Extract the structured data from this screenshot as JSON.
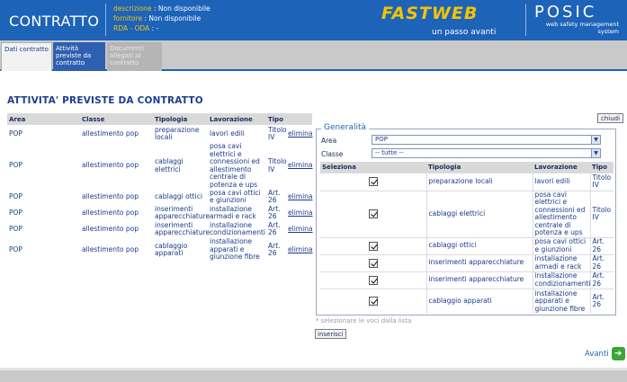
{
  "header": {
    "title": "CONTRATTO",
    "meta": [
      {
        "key": "descrizione",
        "value": ": Non disponibile"
      },
      {
        "key": "fornitore",
        "value": ": Non disponibile"
      },
      {
        "key": "RDA - ODA",
        "value": ": -"
      }
    ],
    "brand": "FASTWEB",
    "brand_tagline": "un passo avanti",
    "product": "POSIC",
    "product_tagline": "web safety management system"
  },
  "tabs": [
    {
      "label": "Dati contratto",
      "state": "inactive"
    },
    {
      "label": "Attività previste da contratto",
      "state": "active"
    },
    {
      "label": "Documenti allegati al contratto",
      "state": "disabled"
    }
  ],
  "page_title": "ATTIVITA' PREVISTE DA CONTRATTO",
  "left_table": {
    "headers": [
      "Area",
      "Classe",
      "Tipologia",
      "Lavorazione",
      "Tipo",
      ""
    ],
    "rows": [
      {
        "area": "POP",
        "classe": "allestimento pop",
        "tipologia": "preparazione locali",
        "lavorazione": "lavori edili",
        "tipo": "Titolo IV",
        "action": "elimina"
      },
      {
        "area": "POP",
        "classe": "allestimento pop",
        "tipologia": "cablaggi elettrici",
        "lavorazione": "posa cavi elettrici e connessioni ed allestimento centrale di potenza e ups",
        "tipo": "Titolo IV",
        "action": "elimina"
      },
      {
        "area": "POP",
        "classe": "allestimento pop",
        "tipologia": "cablaggi ottici",
        "lavorazione": "posa cavi ottici e giunzioni",
        "tipo": "Art. 26",
        "action": "elimina"
      },
      {
        "area": "POP",
        "classe": "allestimento pop",
        "tipologia": "inserimenti apparecchiature",
        "lavorazione": "installazione armadi e rack",
        "tipo": "Art. 26",
        "action": "elimina"
      },
      {
        "area": "POP",
        "classe": "allestimento pop",
        "tipologia": "inserimenti apparecchiature",
        "lavorazione": "installazione condizionamenti",
        "tipo": "Art. 26",
        "action": "elimina"
      },
      {
        "area": "POP",
        "classe": "allestimento pop",
        "tipologia": "cablaggio apparati",
        "lavorazione": "installazione apparati e giunzione fibre",
        "tipo": "Art. 26",
        "action": "elimina"
      }
    ]
  },
  "close_label": "chiudi",
  "form": {
    "legend": "Generalità",
    "area_label": "Area",
    "area_value": "POP",
    "classe_label": "Classe",
    "classe_value": "-- tutte --"
  },
  "right_table": {
    "headers": [
      "Seleziona",
      "Tipologia",
      "Lavorazione",
      "Tipo"
    ],
    "rows": [
      {
        "checked": true,
        "tipologia": "preparazione locali",
        "lavorazione": "lavori edili",
        "tipo": "Titolo IV"
      },
      {
        "checked": true,
        "tipologia": "cablaggi elettrici",
        "lavorazione": "posa cavi elettrici e connessioni ed allestimento centrale di potenza e ups",
        "tipo": "Titolo IV"
      },
      {
        "checked": true,
        "tipologia": "cablaggi ottici",
        "lavorazione": "posa cavi ottici e giunzioni",
        "tipo": "Art. 26"
      },
      {
        "checked": true,
        "tipologia": "inserimenti apparecchiature",
        "lavorazione": "installazione armadi e rack",
        "tipo": "Art. 26"
      },
      {
        "checked": true,
        "tipologia": "inserimenti apparecchiature",
        "lavorazione": "installazione condizionamenti",
        "tipo": "Art. 26"
      },
      {
        "checked": true,
        "tipologia": "cablaggio apparati",
        "lavorazione": "installazione apparati e giunzione fibre",
        "tipo": "Art. 26"
      }
    ]
  },
  "hint": "* selezionare le voci dalla lista",
  "insert_label": "inserisci",
  "next_label": "Avanti",
  "colors": {
    "header_bg": "#1d63b8",
    "brand": "#f4c400",
    "meta_key": "#f1c40f",
    "next_icon": "#3aa63a"
  }
}
